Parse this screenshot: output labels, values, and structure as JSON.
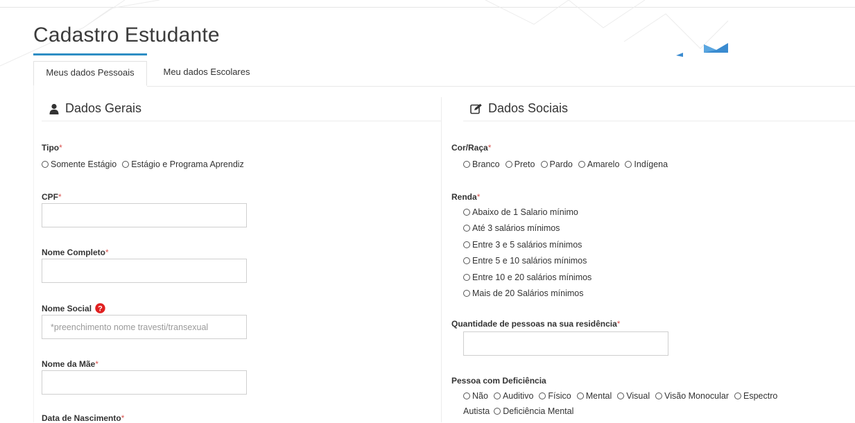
{
  "page": {
    "title": "Cadastro Estudante"
  },
  "tabs": [
    {
      "label": "Meus dados Pessoais",
      "active": true
    },
    {
      "label": "Meu dados Escolares",
      "active": false
    }
  ],
  "colors": {
    "accent": "#2e8ec4",
    "required": "#d9534f",
    "help": "#e02020",
    "logo_blue": "#3a8bd0"
  },
  "dados_gerais": {
    "title": "Dados Gerais",
    "icon": "user-icon",
    "tipo": {
      "label": "Tipo",
      "required_mark": "*",
      "options": [
        "Somente Estágio",
        "Estágio e Programa Aprendiz"
      ]
    },
    "cpf": {
      "label": "CPF",
      "required_mark": "*",
      "value": "",
      "placeholder": ""
    },
    "nome_completo": {
      "label": "Nome Completo",
      "required_mark": "*",
      "value": "",
      "placeholder": ""
    },
    "nome_social": {
      "label": "Nome Social",
      "help_icon": "question-circle-icon",
      "value": "",
      "placeholder": "*preenchimento nome travesti/transexual"
    },
    "nome_mae": {
      "label": "Nome da Mãe",
      "required_mark": "*",
      "value": "",
      "placeholder": ""
    },
    "data_nascimento": {
      "label": "Data de Nascimento",
      "required_mark": "*"
    }
  },
  "dados_sociais": {
    "title": "Dados Sociais",
    "icon": "edit-icon",
    "cor_raca": {
      "label": "Cor/Raça",
      "required_mark": "*",
      "options": [
        "Branco",
        "Preto",
        "Pardo",
        "Amarelo",
        "Indígena"
      ]
    },
    "renda": {
      "label": "Renda",
      "required_mark": "*",
      "options": [
        "Abaixo de 1 Salario mínimo",
        "Até 3 salários mínimos",
        "Entre 3 e 5 salários mínimos",
        "Entre 5 e 10 salários mínimos",
        "Entre 10 e 20 salários mínimos",
        "Mais de 20 Salários mínimos"
      ]
    },
    "qtd_pessoas": {
      "label": "Quantidade de pessoas na sua residência",
      "required_mark": "*",
      "value": ""
    },
    "deficiencia": {
      "label": "Pessoa com Deficiência",
      "options_line1": [
        "Não",
        "Auditivo",
        "Físico",
        "Mental",
        "Visual",
        "Visão Monocular",
        "Espectro"
      ],
      "options_line2_prefix": "Autista",
      "options_line2": [
        "Deficiência Mental"
      ]
    }
  }
}
